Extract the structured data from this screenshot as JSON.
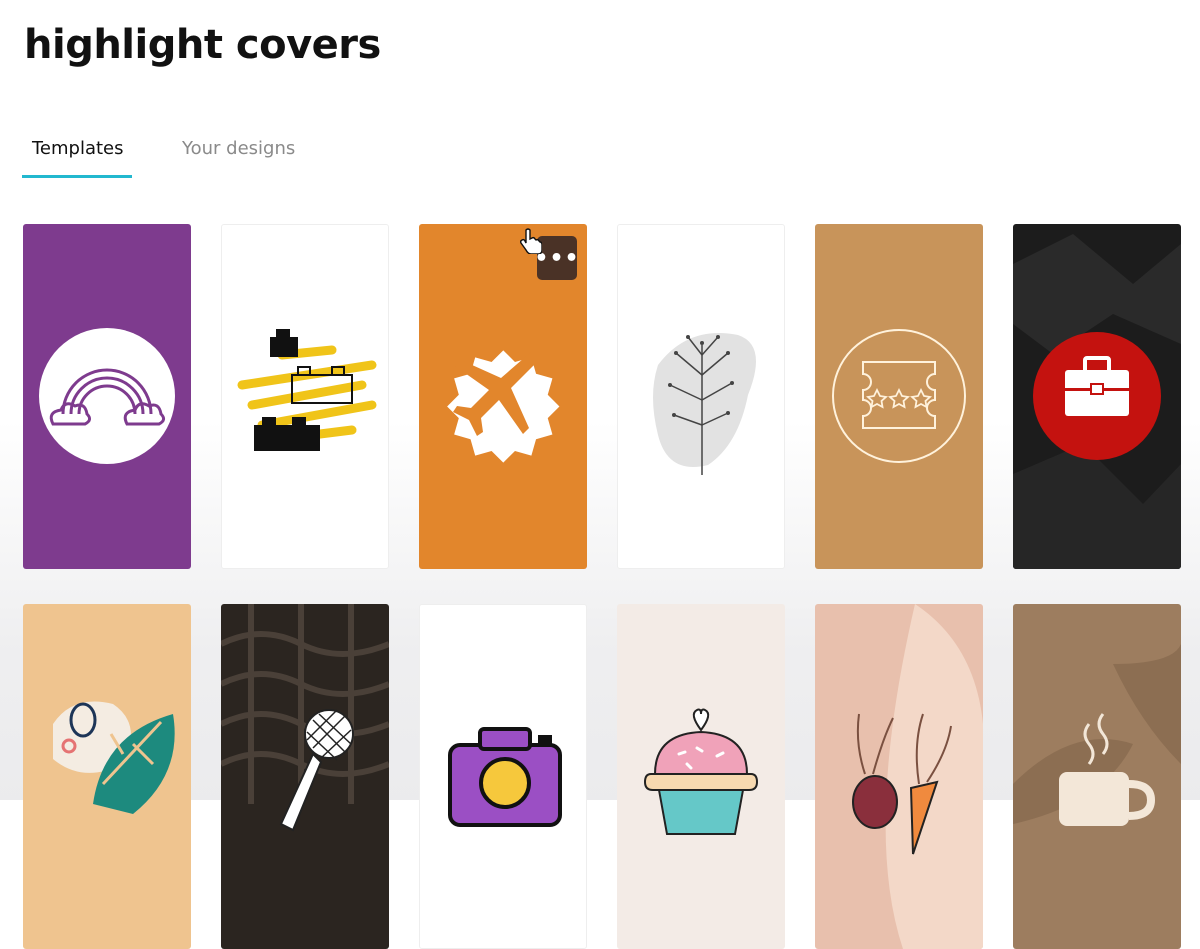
{
  "page": {
    "title": "highlight covers"
  },
  "tabs": [
    {
      "label": "Templates",
      "active": true
    },
    {
      "label": "Your designs",
      "active": false
    }
  ],
  "templates": {
    "row1": [
      {
        "name": "rainbow-cover",
        "bg": "#7e3b8e"
      },
      {
        "name": "lego-cover",
        "bg": "#ffffff"
      },
      {
        "name": "airplane-cover",
        "bg": "#e2862c",
        "hovered": true
      },
      {
        "name": "plant-cover",
        "bg": "#ffffff"
      },
      {
        "name": "ticket-cover",
        "bg": "#c8945a"
      },
      {
        "name": "briefcase-cover",
        "bg": "#1c1c1c"
      }
    ],
    "row2": [
      {
        "name": "monstera-leaf-cover",
        "bg": "#efc48f"
      },
      {
        "name": "microphone-cover",
        "bg": "#2b2520"
      },
      {
        "name": "camera-cover",
        "bg": "#ffffff"
      },
      {
        "name": "cupcake-cover",
        "bg": "#f3ebe6"
      },
      {
        "name": "vegetables-cover",
        "bg": "#e8c0ad"
      },
      {
        "name": "coffee-cup-cover",
        "bg": "#9d7d5f"
      }
    ]
  },
  "hover_menu": {
    "label": "•••"
  }
}
